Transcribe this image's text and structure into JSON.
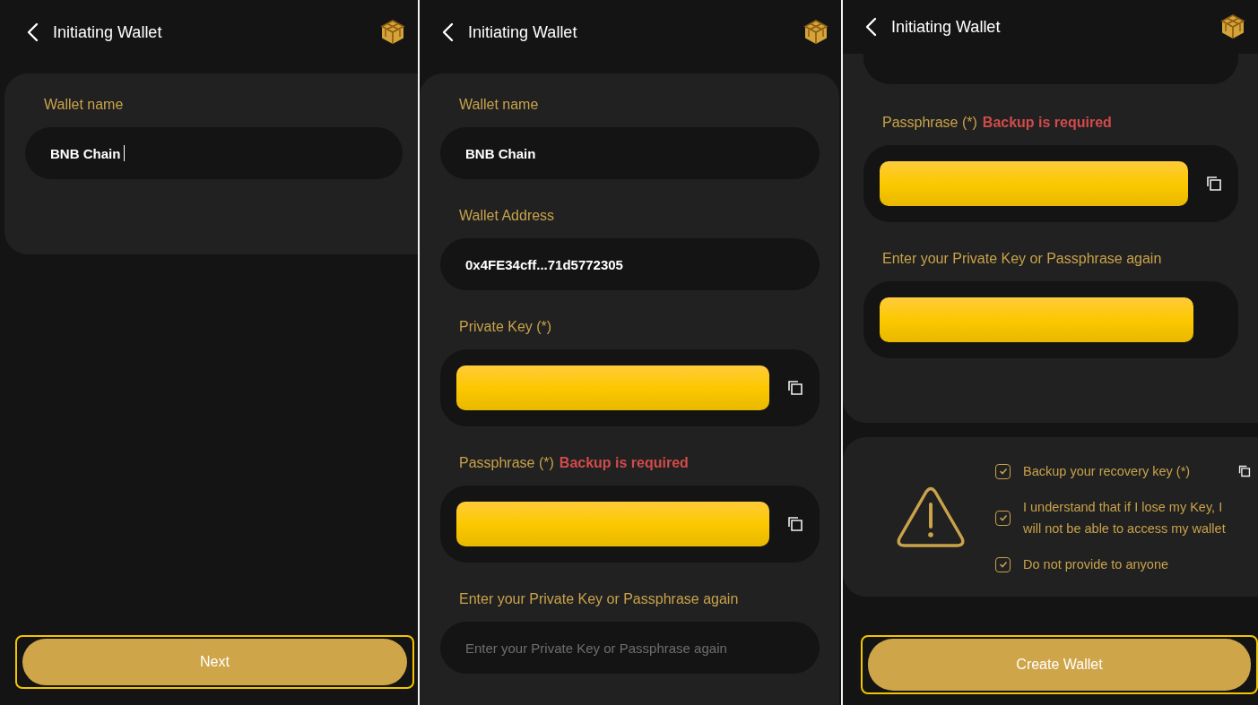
{
  "screens": [
    {
      "title": "Initiating Wallet",
      "sections": [
        {
          "kind": "card",
          "fields": [
            {
              "kind": "text",
              "label": "Wallet name",
              "value": "BNB Chain",
              "cursor": true
            }
          ]
        }
      ],
      "button": {
        "label": "Next",
        "focused": true
      }
    },
    {
      "title": "Initiating Wallet",
      "sections": [
        {
          "kind": "card",
          "fields": [
            {
              "kind": "text",
              "label": "Wallet name",
              "value": "BNB Chain",
              "cursor": false
            },
            {
              "kind": "text",
              "label": "Wallet Address",
              "value": "0x4FE34cff...71d5772305",
              "cursor": false
            },
            {
              "kind": "secret",
              "label": "Private Key (*)",
              "copy": true
            },
            {
              "kind": "secret",
              "label": "Passphrase (*)",
              "note": "Backup is required",
              "copy": true
            },
            {
              "kind": "input",
              "label": "Enter your Private Key or Passphrase again",
              "placeholder": "Enter your Private Key or Passphrase again"
            }
          ]
        }
      ]
    },
    {
      "title": "Initiating Wallet",
      "sections": [
        {
          "kind": "card",
          "fields": [
            {
              "kind": "cut"
            },
            {
              "kind": "secret",
              "label": "Passphrase (*)",
              "note": "Backup is required",
              "copy": true
            },
            {
              "kind": "secret",
              "label": "Enter your Private Key or Passphrase again",
              "copy": false
            }
          ]
        },
        {
          "kind": "warning",
          "items": [
            {
              "text": "Backup your recovery key (*)",
              "checked": true,
              "copy": true
            },
            {
              "text": "I understand that if I lose my Key, I will not be able to access my wallet",
              "checked": true,
              "copy": false
            },
            {
              "text": "Do not provide to anyone",
              "checked": true,
              "copy": false
            }
          ]
        }
      ],
      "button": {
        "label": "Create Wallet",
        "focused": true
      }
    }
  ]
}
